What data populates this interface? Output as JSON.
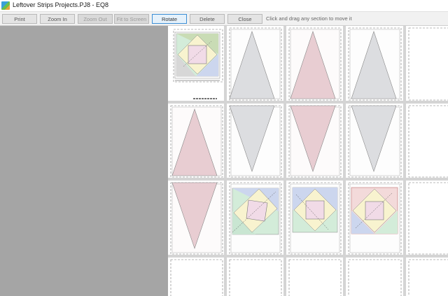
{
  "window": {
    "title": "Leftover Strips Projects.PJ8 - EQ8"
  },
  "toolbar": {
    "print_label": "Print",
    "zoom_in_label": "Zoom In",
    "zoom_out_label": "Zoom Out",
    "fit_to_screen_label": "Fit to Screen",
    "rotate_label": "Rotate",
    "delete_label": "Delete",
    "close_label": "Close",
    "hint_text": "Click and drag any section to move it"
  },
  "colors": {
    "pink_diamond": "#e8cdd2",
    "gray_diamond": "#dcdde0",
    "block_yellow": "#f8f3cf",
    "block_green": "#d2ead6",
    "block_blue": "#ccd6ee",
    "block_pink": "#f1dbe7",
    "left_pane": "#a5a5a5"
  },
  "icons": {
    "app_icon": "eq8-app-icon"
  }
}
